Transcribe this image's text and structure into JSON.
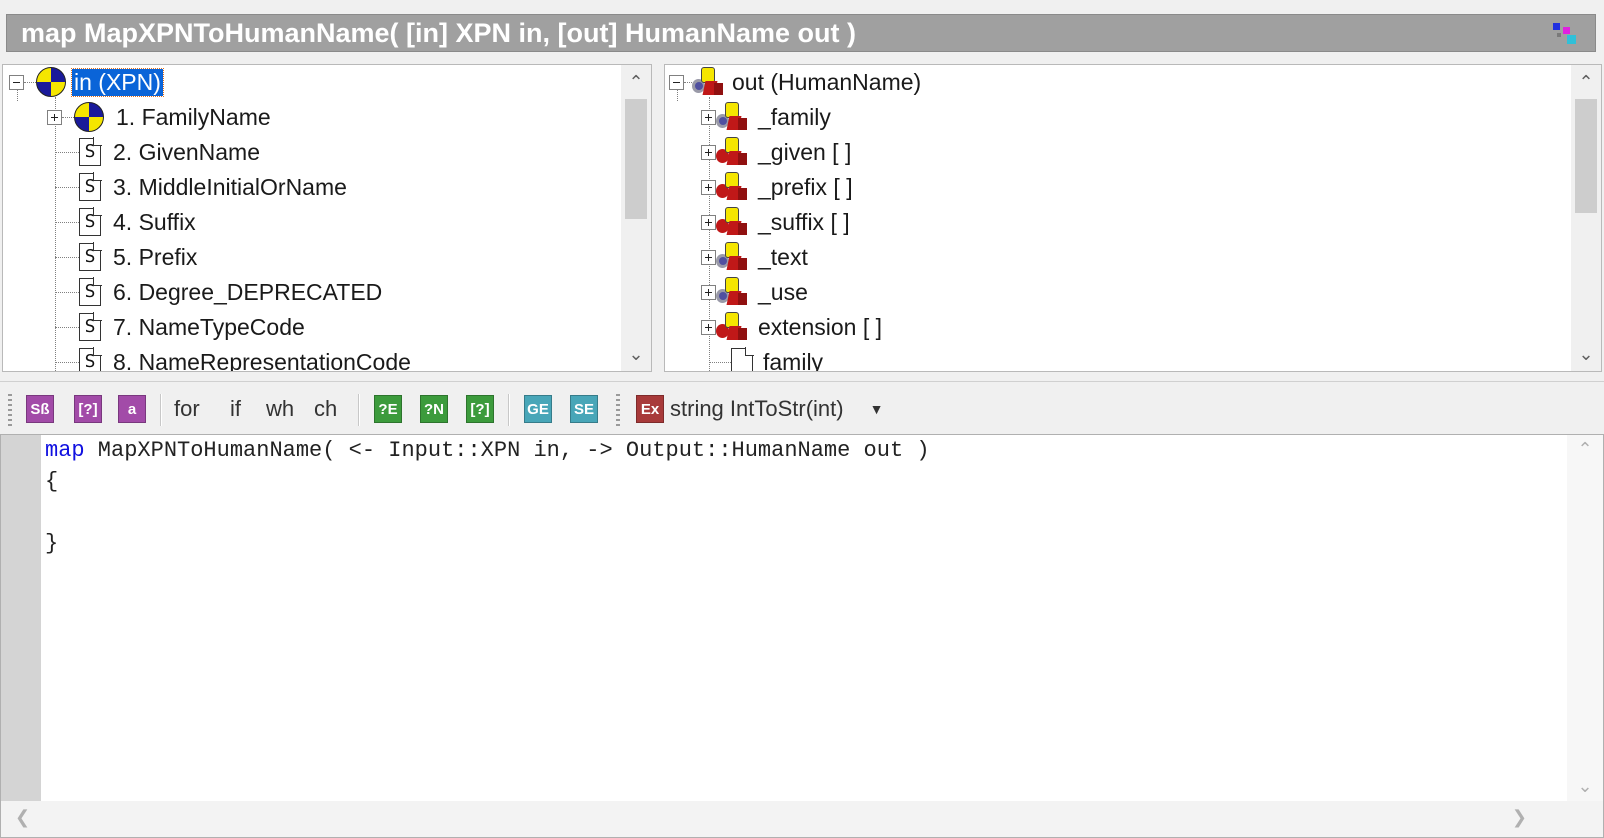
{
  "window": {
    "title": "map MapXPNToHumanName( [in] XPN in, [out] HumanName out )",
    "title_icon": "restore-window-icon"
  },
  "input_tree": {
    "root": {
      "label": "in (XPN)",
      "icon": "compound-type-icon",
      "expander": "minus"
    },
    "items": [
      {
        "label": "1. FamilyName",
        "icon": "compound-type-icon",
        "expander": "plus"
      },
      {
        "label": "2. GivenName",
        "icon": "string-field-icon"
      },
      {
        "label": "3. MiddleInitialOrName",
        "icon": "string-field-icon"
      },
      {
        "label": "4. Suffix",
        "icon": "string-field-icon"
      },
      {
        "label": "5. Prefix",
        "icon": "string-field-icon"
      },
      {
        "label": "6. Degree_DEPRECATED",
        "icon": "string-field-icon"
      },
      {
        "label": "7. NameTypeCode",
        "icon": "string-field-icon"
      },
      {
        "label": "8. NameRepresentationCode",
        "icon": "string-field-icon"
      }
    ]
  },
  "output_tree": {
    "root": {
      "label": "out (HumanName)",
      "icon": "object-type-icon",
      "expander": "minus"
    },
    "items": [
      {
        "label": "_family",
        "icon": "object-type-icon",
        "expander": "plus"
      },
      {
        "label": "_given [ ]",
        "icon": "object-array-icon",
        "expander": "plus"
      },
      {
        "label": "_prefix [ ]",
        "icon": "object-array-icon",
        "expander": "plus"
      },
      {
        "label": "_suffix [ ]",
        "icon": "object-array-icon",
        "expander": "plus"
      },
      {
        "label": "_text",
        "icon": "object-type-icon",
        "expander": "plus"
      },
      {
        "label": "_use",
        "icon": "object-type-icon",
        "expander": "plus"
      },
      {
        "label": "extension [ ]",
        "icon": "object-array-icon",
        "expander": "plus"
      },
      {
        "label": "family",
        "icon": "string-field-icon"
      }
    ]
  },
  "toolbar": {
    "buttons": [
      {
        "name": "sb-button",
        "glyph": "Sß",
        "color": "#a24ba8"
      },
      {
        "name": "question-button",
        "glyph": "[?]",
        "color": "#a24ba8"
      },
      {
        "name": "a-button",
        "glyph": "a",
        "color": "#a24ba8"
      }
    ],
    "keywords": [
      "for",
      "if",
      "wh",
      "ch"
    ],
    "green_buttons": [
      "?E",
      "?N",
      "[?]"
    ],
    "teal_buttons": [
      "GE",
      "SE"
    ],
    "function_icon": "Ex",
    "function_label": "string IntToStr(int)",
    "dropdown_icon": "caret-down-icon"
  },
  "editor": {
    "lines": [
      {
        "keyword": "map",
        "rest": " MapXPNToHumanName( <- Input::XPN in, -> Output::HumanName out )"
      },
      {
        "keyword": "",
        "rest": "{"
      },
      {
        "keyword": "",
        "rest": ""
      },
      {
        "keyword": "",
        "rest": "}"
      }
    ]
  },
  "colors": {
    "title_bar": "#a0a0a0",
    "selection": "#0a64d8",
    "keyword": "#1010e0"
  }
}
